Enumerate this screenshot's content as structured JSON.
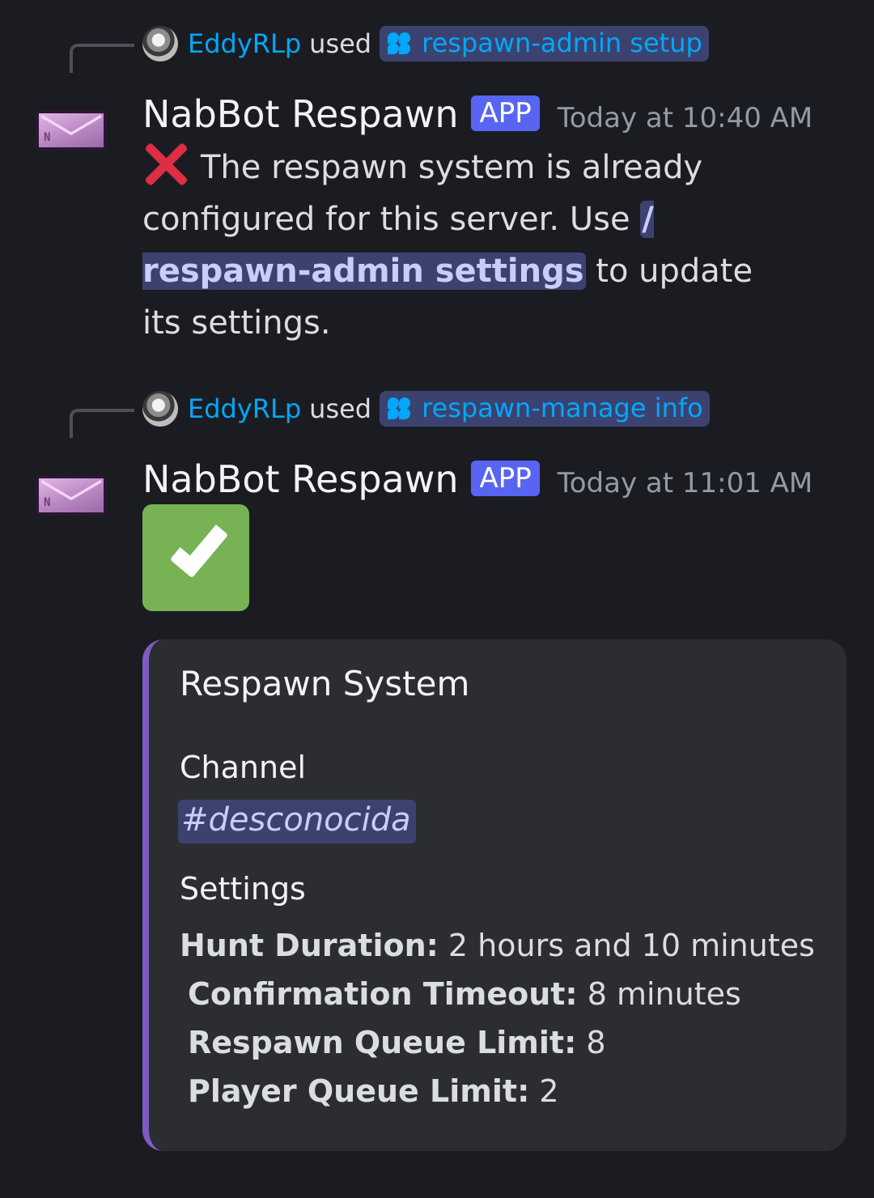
{
  "messages": [
    {
      "reference": {
        "user": "EddyRLp",
        "used_text": "used",
        "command": "respawn-admin setup"
      },
      "author": "NabBot Respawn",
      "app_tag": "APP",
      "timestamp": "Today at 10:40 AM",
      "emoji": "cross-mark",
      "text_before": "The respawn system is already configured for this server. Use",
      "command_mention": "/ respawn-admin settings",
      "text_after": "to update its settings."
    },
    {
      "reference": {
        "user": "EddyRLp",
        "used_text": "used",
        "command": "respawn-manage info"
      },
      "author": "NabBot Respawn",
      "app_tag": "APP",
      "timestamp": "Today at 11:01 AM",
      "emoji": "check-mark-button",
      "embed": {
        "accent_color": "#7e5bc2",
        "title": "Respawn System",
        "channel_label": "Channel",
        "channel_value": "#desconocida",
        "settings_label": "Settings",
        "settings": [
          {
            "label": "Hunt Duration:",
            "value": "2 hours and 10 minutes"
          },
          {
            "label": "Confirmation Timeout:",
            "value": "8 minutes"
          },
          {
            "label": "Respawn Queue Limit:",
            "value": "8"
          },
          {
            "label": "Player Queue Limit:",
            "value": "2"
          }
        ]
      }
    }
  ],
  "colors": {
    "background": "#1b1c22",
    "username_link": "#00a8fc",
    "app_tag": "#5865f2",
    "mention_bg": "#3c4270",
    "error_red": "#dd2e44",
    "success_green": "#77b255"
  }
}
